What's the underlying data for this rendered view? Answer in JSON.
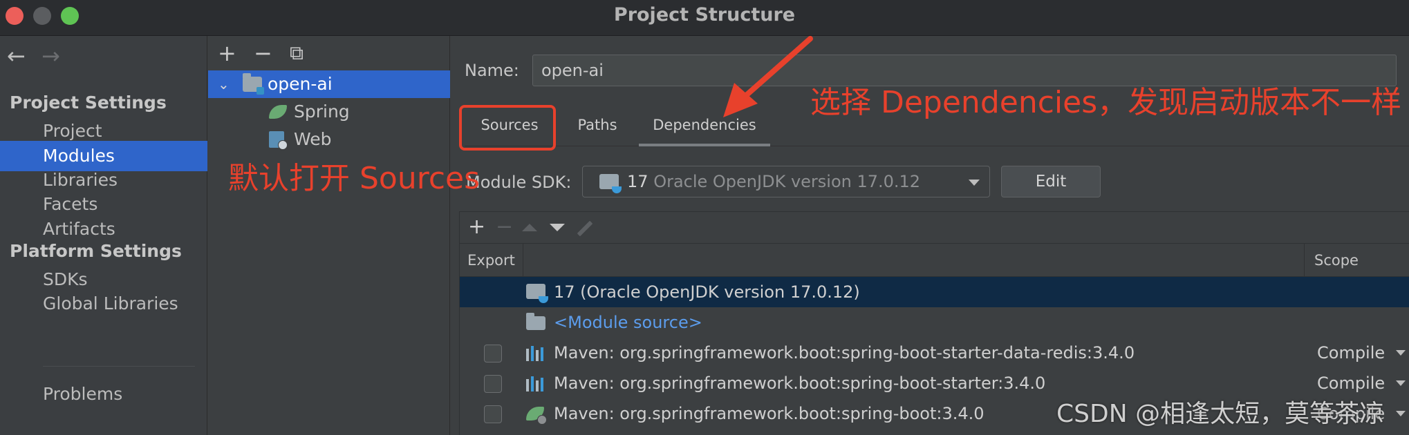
{
  "window": {
    "title": "Project Structure"
  },
  "nav": {
    "back": "←",
    "forward": "→",
    "project_settings": "Project Settings",
    "project_items": [
      "Project",
      "Modules",
      "Libraries",
      "Facets",
      "Artifacts"
    ],
    "platform_settings": "Platform Settings",
    "platform_items": [
      "SDKs",
      "Global Libraries"
    ],
    "problems": "Problems"
  },
  "tree": {
    "add": "+",
    "remove": "−",
    "copy": "⧉",
    "root": "open-ai",
    "children": [
      "Spring",
      "Web"
    ]
  },
  "module": {
    "name_label": "Name:",
    "name_value": "open-ai",
    "tabs": [
      "Sources",
      "Paths",
      "Dependencies"
    ],
    "sdk_label": "Module SDK:",
    "sdk_version": "17",
    "sdk_detail": "Oracle OpenJDK version 17.0.12",
    "edit": "Edit"
  },
  "dependencies": {
    "add": "+",
    "remove": "−",
    "headers": {
      "export": "Export",
      "scope": "Scope"
    },
    "rows": [
      {
        "text": "17 (Oracle OpenJDK version 17.0.12)",
        "scope": ""
      },
      {
        "text": "<Module source>",
        "scope": ""
      },
      {
        "text": "Maven: org.springframework.boot:spring-boot-starter-data-redis:3.4.0",
        "scope": "Compile"
      },
      {
        "text": "Maven: org.springframework.boot:spring-boot-starter:3.4.0",
        "scope": "Compile"
      },
      {
        "text": "Maven: org.springframework.boot:spring-boot:3.4.0",
        "scope": "Compile"
      }
    ]
  },
  "annotations": {
    "left": "默认打开 Sources",
    "right": "选择 Dependencies，发现启动版本不一样",
    "color": "#e8412c"
  },
  "watermark": "CSDN @相逢太短，莫等茶凉"
}
